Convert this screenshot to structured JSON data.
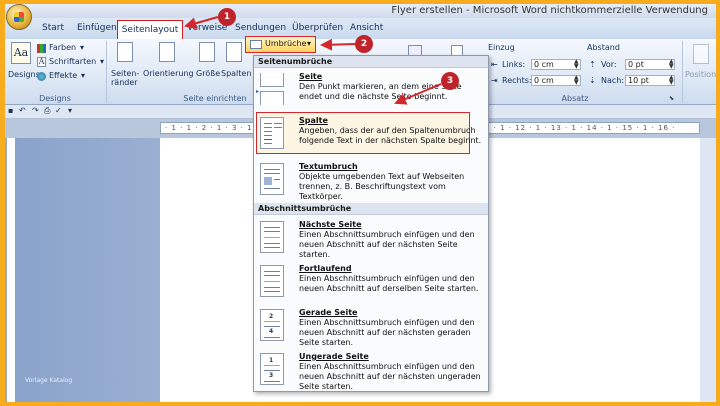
{
  "window": {
    "title": "Flyer erstellen - Microsoft Word nichtkommerzielle Verwendung"
  },
  "tabs": {
    "start": "Start",
    "einfuegen": "Einfügen",
    "seitenlayout": "Seitenlayout",
    "verweise": "Verweise",
    "sendungen": "Sendungen",
    "ueberpruefen": "Überprüfen",
    "ansicht": "Ansicht"
  },
  "ribbon": {
    "designs": {
      "label": "Designs",
      "farben": "Farben",
      "schriftarten": "Schriftarten",
      "effekte": "Effekte",
      "group": "Designs"
    },
    "seite": {
      "seitenraender": "Seiten-\nränder",
      "orientierung": "Orientierung",
      "groesse": "Größe",
      "spalten": "Spalten",
      "group": "Seite einrichten"
    },
    "umbrueche": "Umbrüche",
    "einzug": {
      "title": "Einzug",
      "links_label": "Links:",
      "links_value": "0 cm",
      "rechts_label": "Rechts:",
      "rechts_value": "0 cm"
    },
    "abstand": {
      "title": "Abstand",
      "vor_label": "Vor:",
      "vor_value": "0 pt",
      "nach_label": "Nach:",
      "nach_value": "10 pt"
    },
    "absatz_group": "Absatz",
    "position": "Position"
  },
  "ruler": "· 1 · 1 · 2 · 1 · 3 · 1 · 4 · 1 · 5 · 1 · 6 · 1 · 7 · 1 · 8 · 1 · 9 · 1 · 10 · 1 · 11 · 1 · 12 · 1 · 13 · 1 · 14 · 1 · 15 · 1 · 16 ·",
  "sidebar_label": "Vorlage Katalog",
  "menu": {
    "section1": "Seitenumbrüche",
    "section2": "Abschnittsumbrüche",
    "items": [
      {
        "title": "Seite",
        "desc": "Den Punkt markieren, an dem eine Seite endet und die nächste Seite beginnt."
      },
      {
        "title": "Spalte",
        "desc": "Angeben, dass der auf den Spaltenumbruch folgende Text in der nächsten Spalte beginnt."
      },
      {
        "title": "Textumbruch",
        "desc": "Objekte umgebenden Text auf Webseiten trennen, z. B. Beschriftungstext vom Textkörper."
      },
      {
        "title": "Nächste Seite",
        "desc": "Einen Abschnittsumbruch einfügen und den neuen Abschnitt auf der nächsten Seite starten."
      },
      {
        "title": "Fortlaufend",
        "desc": "Einen Abschnittsumbruch einfügen und den neuen Abschnitt auf derselben Seite starten."
      },
      {
        "title": "Gerade Seite",
        "desc": "Einen Abschnittsumbruch einfügen und den neuen Abschnitt auf der nächsten geraden Seite starten."
      },
      {
        "title": "Ungerade Seite",
        "desc": "Einen Abschnittsumbruch einfügen und den neuen Abschnitt auf der nächsten ungeraden Seite starten."
      }
    ]
  },
  "annotations": {
    "one": "1",
    "two": "2",
    "three": "3"
  },
  "colors": {
    "highlight_red": "#d5262b",
    "frame_orange": "#f6ac1c",
    "ribbon_blue": "#dbe6f4"
  }
}
